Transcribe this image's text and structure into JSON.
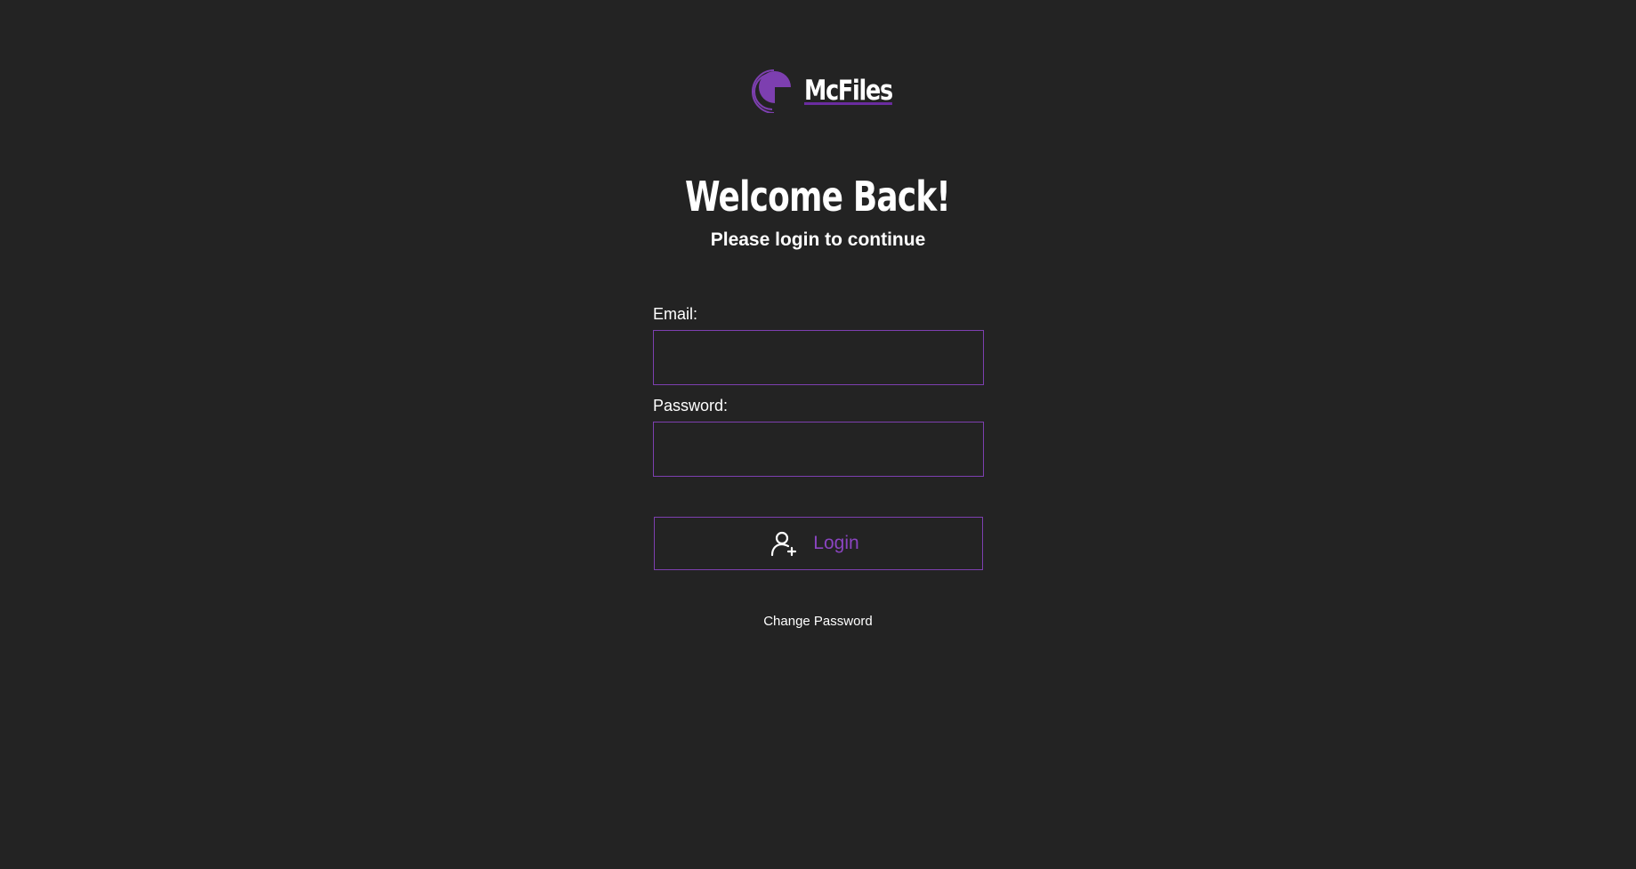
{
  "brand": {
    "name": "McFiles",
    "logo_icon": "mcfiles-logo-icon",
    "accent_color": "#7d3fb0"
  },
  "header": {
    "title": "Welcome Back!",
    "subtitle": "Please login to continue"
  },
  "form": {
    "email_label": "Email:",
    "email_value": "",
    "password_label": "Password:",
    "password_value": ""
  },
  "login_button": {
    "label": "Login",
    "icon": "user-plus-icon"
  },
  "links": {
    "change_password": "Change Password"
  }
}
